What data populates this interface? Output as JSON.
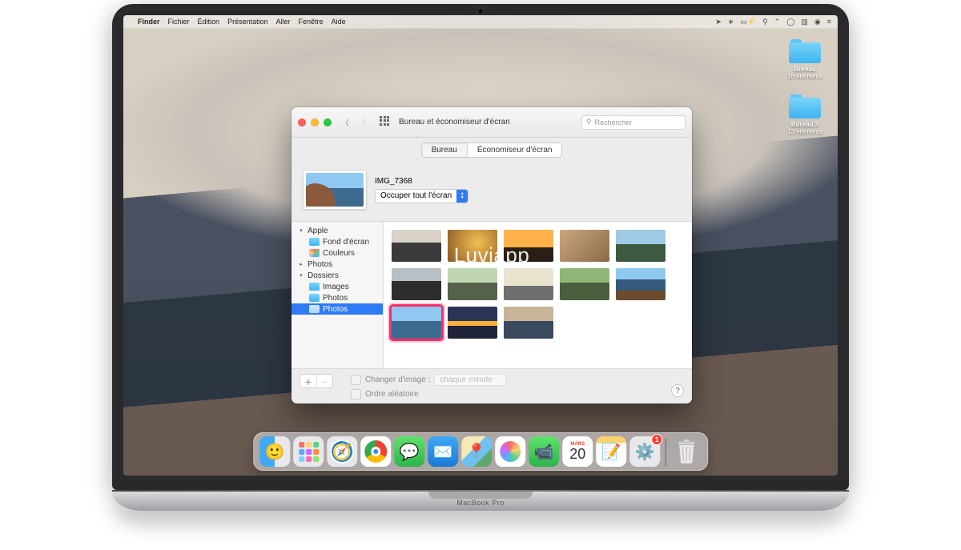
{
  "menubar": {
    "app": "Finder",
    "items": [
      "Fichier",
      "Édition",
      "Présentation",
      "Aller",
      "Fenêtre",
      "Aide"
    ]
  },
  "desktop_icons": [
    {
      "name": "Bureau",
      "sub": "16 éléments"
    },
    {
      "name": "Bureau 3",
      "sub": "13 éléments"
    }
  ],
  "window": {
    "title": "Bureau et économiseur d'écran",
    "search_placeholder": "Rechercher",
    "tabs": {
      "desktop": "Bureau",
      "screensaver": "Économiseur d'écran",
      "active": "desktop"
    },
    "current_image_name": "IMG_7368",
    "fit_mode": "Occuper tout l'écran",
    "sidebar": {
      "apple": {
        "label": "Apple",
        "items": [
          {
            "label": "Fond d'écran",
            "icon": "folder"
          },
          {
            "label": "Couleurs",
            "icon": "colors"
          }
        ]
      },
      "photos": {
        "label": "Photos"
      },
      "dossiers": {
        "label": "Dossiers",
        "items": [
          {
            "label": "Images"
          },
          {
            "label": "Photos"
          },
          {
            "label": "Photos",
            "selected": true
          }
        ]
      }
    },
    "selected_thumb_index": 10,
    "footer": {
      "change_label": "Changer d'image :",
      "interval": "chaque minute",
      "random_label": "Ordre aléatoire"
    }
  },
  "dock": {
    "calendar": {
      "month": "MARS",
      "day": "20"
    },
    "settings_badge": "1"
  },
  "laptop_label": "MacBook Pro",
  "watermark": "Luviapp"
}
